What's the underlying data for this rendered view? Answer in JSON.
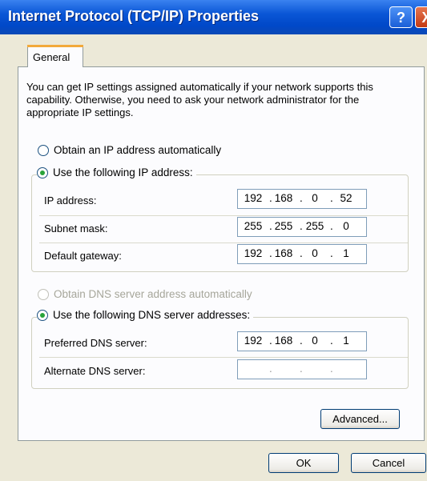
{
  "window": {
    "title": "Internet Protocol (TCP/IP) Properties",
    "help_button": "?",
    "close_button": "X"
  },
  "tabs": [
    {
      "label": "General",
      "selected": true
    }
  ],
  "intro_text": "You can get IP settings assigned automatically if your network supports this capability. Otherwise, you need to ask your network administrator for the appropriate IP settings.",
  "ip_settings": {
    "auto_option": {
      "label": "Obtain an IP address automatically",
      "selected": false
    },
    "manual_option": {
      "label": "Use the following IP address:",
      "selected": true
    },
    "fields": [
      {
        "label": "IP address:",
        "octets": [
          "192",
          "168",
          "0",
          "52"
        ]
      },
      {
        "label": "Subnet mask:",
        "octets": [
          "255",
          "255",
          "255",
          "0"
        ]
      },
      {
        "label": "Default gateway:",
        "octets": [
          "192",
          "168",
          "0",
          "1"
        ]
      }
    ]
  },
  "dns_settings": {
    "auto_option": {
      "label": "Obtain DNS server address automatically",
      "selected": false,
      "enabled": false
    },
    "manual_option": {
      "label": "Use the following DNS server addresses:",
      "selected": true
    },
    "fields": [
      {
        "label": "Preferred DNS server:",
        "octets": [
          "192",
          "168",
          "0",
          "1"
        ]
      },
      {
        "label": "Alternate DNS server:",
        "octets": [
          "",
          "",
          "",
          ""
        ]
      }
    ]
  },
  "buttons": {
    "advanced": "Advanced...",
    "ok": "OK",
    "cancel": "Cancel"
  },
  "colors": {
    "title_bar": "#0a56d6",
    "dialog_background": "#ece9d8",
    "radio_selected_dot": "#29a33a",
    "tab_highlight": "#f2a93b"
  }
}
